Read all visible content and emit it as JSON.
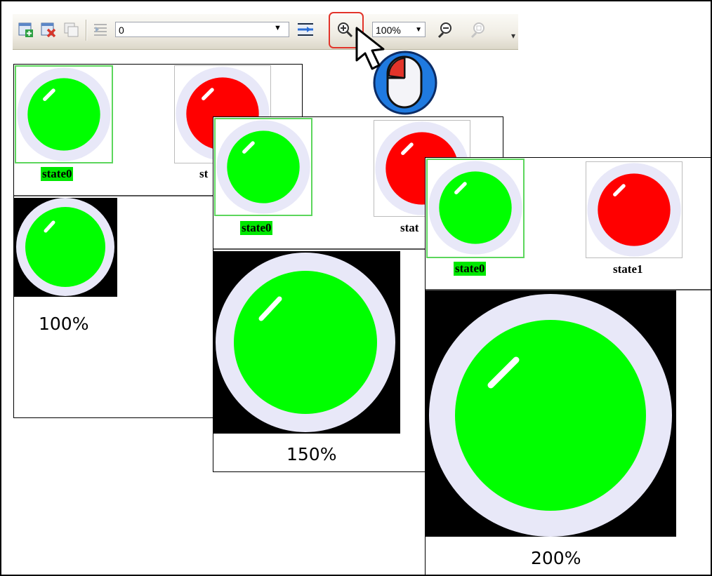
{
  "toolbar": {
    "frame_value": "0",
    "zoom_value": "100%",
    "icons": [
      "add-frame-icon",
      "delete-frame-icon",
      "copy-frame-icon",
      "frame-list-icon",
      "frame-settings-icon",
      "zoom-in-icon",
      "zoom-out-icon",
      "zoom-reset-icon",
      "toolbar-overflow-icon"
    ]
  },
  "states": {
    "state0": "state0",
    "state1": "state1"
  },
  "panels": {
    "p100": {
      "zoom": "100%",
      "state1_label": "st"
    },
    "p150": {
      "zoom": "150%",
      "state1_label": "stat"
    },
    "p200": {
      "zoom": "200%"
    }
  },
  "colors": {
    "on": "#00ff00",
    "off": "#ff0000",
    "ring": "#e8e8f8",
    "selected_border": "#5cd65c",
    "highlight": "#e2342a"
  }
}
